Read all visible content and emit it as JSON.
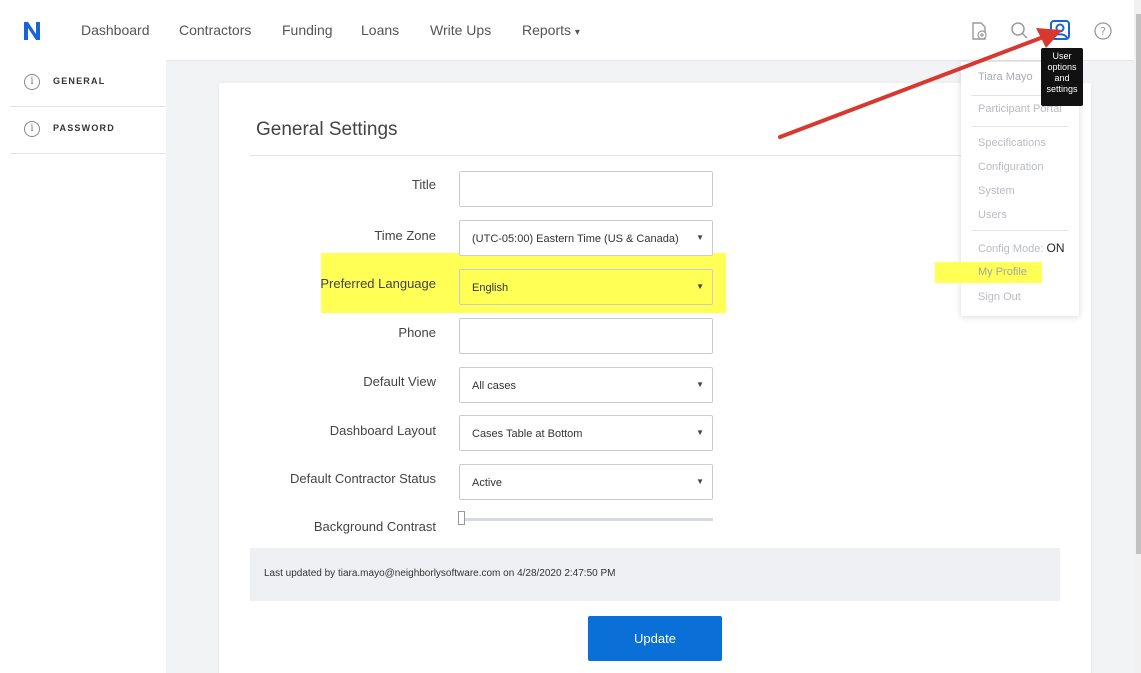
{
  "nav": {
    "items": [
      "Dashboard",
      "Contractors",
      "Funding",
      "Loans",
      "Write Ups",
      "Reports"
    ],
    "reports_caret": "▾",
    "tooltip": [
      "User",
      "options",
      "and",
      "settings"
    ]
  },
  "sidebar": {
    "items": [
      {
        "label": "GENERAL",
        "icon": "info-icon"
      },
      {
        "label": "PASSWORD",
        "icon": "info-icon"
      }
    ]
  },
  "form": {
    "title": "General Settings",
    "fields": [
      {
        "label": "Title",
        "value": "",
        "type": "text"
      },
      {
        "label": "Time Zone",
        "value": "(UTC-05:00) Eastern Time (US & Canada)",
        "type": "select"
      },
      {
        "label": "Preferred Language",
        "value": "English",
        "type": "select"
      },
      {
        "label": "Phone",
        "value": "",
        "type": "text"
      },
      {
        "label": "Default View",
        "value": "All cases",
        "type": "select"
      },
      {
        "label": "Dashboard Layout",
        "value": "Cases Table at Bottom",
        "type": "select"
      },
      {
        "label": "Default Contractor Status",
        "value": "Active",
        "type": "select"
      }
    ],
    "background_contrast_label": "Background Contrast",
    "background_contrast_value": 0,
    "last_updated": "Last updated by tiara.mayo@neighborlysoftware.com on 4/28/2020 2:47:50 PM",
    "update_button": "Update"
  },
  "user_menu": {
    "name": "Tiara Mayo",
    "participant_portal": "Participant Portal",
    "specifications": "Specifications",
    "configuration": "Configuration",
    "system": "System",
    "users": "Users",
    "config_mode_label": "Config Mode:",
    "config_mode_value": "ON",
    "my_profile": "My Profile",
    "sign_out": "Sign Out"
  },
  "colors": {
    "brand": "#1a63d6",
    "accent": "#0a6fd6",
    "highlight": "#ffff55",
    "annotation_arrow": "#d9382f"
  }
}
